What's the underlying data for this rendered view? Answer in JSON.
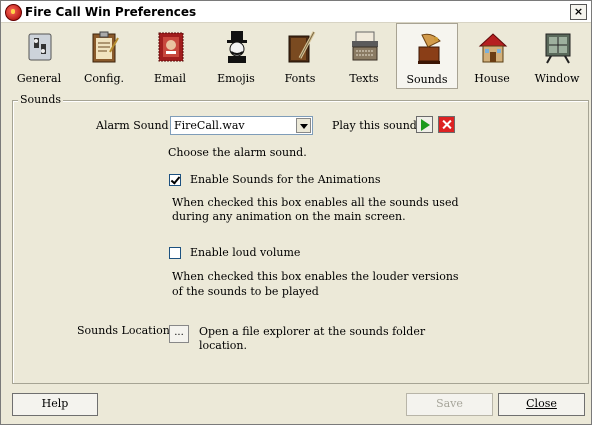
{
  "window": {
    "title": "Fire Call Win Preferences",
    "close_glyph": "×"
  },
  "toolbar": {
    "items": [
      {
        "label": "General",
        "icon": "switch-icon"
      },
      {
        "label": "Config.",
        "icon": "clipboard-icon"
      },
      {
        "label": "Email",
        "icon": "stamp-icon"
      },
      {
        "label": "Emojis",
        "icon": "monopoly-man-icon"
      },
      {
        "label": "Fonts",
        "icon": "book-quill-icon"
      },
      {
        "label": "Texts",
        "icon": "typewriter-icon"
      },
      {
        "label": "Sounds",
        "icon": "gramophone-icon"
      },
      {
        "label": "House",
        "icon": "house-icon"
      },
      {
        "label": "Window",
        "icon": "window-frame-icon"
      }
    ],
    "selected": "Sounds"
  },
  "sounds": {
    "group_title": "Sounds",
    "alarm_label": "Alarm Sound :",
    "alarm_value": "FireCall.wav",
    "play_label": "Play this sound",
    "alarm_hint": "Choose the alarm sound.",
    "enable_anim_label": "Enable Sounds for the Animations",
    "enable_anim_checked": true,
    "enable_anim_desc_1": "When checked this box enables all the sounds used",
    "enable_anim_desc_2": "during any animation on the main screen.",
    "loud_label": "Enable loud volume",
    "loud_checked": false,
    "loud_desc_1": "When checked this box enables the louder versions",
    "loud_desc_2": "of the sounds to be played",
    "location_label": "Sounds Location:",
    "browse_label": "...",
    "location_desc_1": "Open a file explorer at the sounds folder",
    "location_desc_2": "location."
  },
  "footer": {
    "help": "Help",
    "save": "Save",
    "close": "Close"
  }
}
